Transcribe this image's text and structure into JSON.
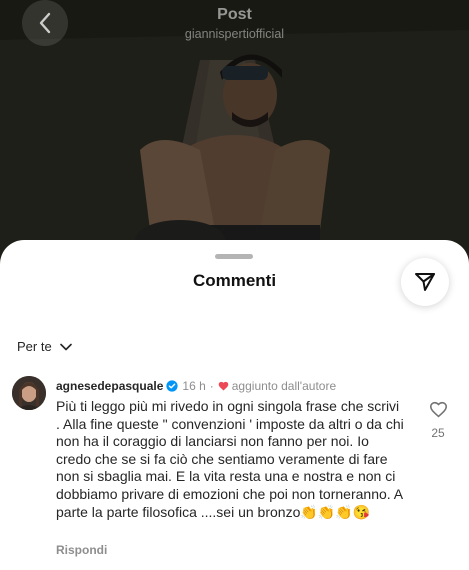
{
  "header": {
    "title": "Post",
    "subtitle": "giannispertiofficial",
    "back_icon": "chevron-left-icon"
  },
  "sheet": {
    "title": "Commenti",
    "share_icon": "paper-plane-icon",
    "filter_label": "Per te",
    "filter_icon": "chevron-down-icon"
  },
  "comment": {
    "username": "agnesedepasquale",
    "verified_icon": "verified-badge-icon",
    "time": "16 h",
    "separator": "·",
    "liked_by_author": "aggiunto dall'autore",
    "text": "Più ti leggo più mi rivedo in ogni singola frase che scrivi . Alla fine queste \" convenzioni ' imposte da altri o da chi non ha il coraggio di lanciarsi non fanno per noi. Io credo che se si fa ciò che sentiamo veramente di fare non si sbaglia mai. E la vita resta una e nostra e non ci dobbiamo privare di emozioni che poi non torneranno.  A parte la parte filosofica ....sei un bronzo👏👏👏😘",
    "like_count": "25",
    "reply_label": "Rispondi"
  },
  "colors": {
    "heart_red": "#ed4956",
    "verified_blue": "#0095f6",
    "text_primary": "#262626",
    "text_secondary": "#8e8e8e"
  }
}
